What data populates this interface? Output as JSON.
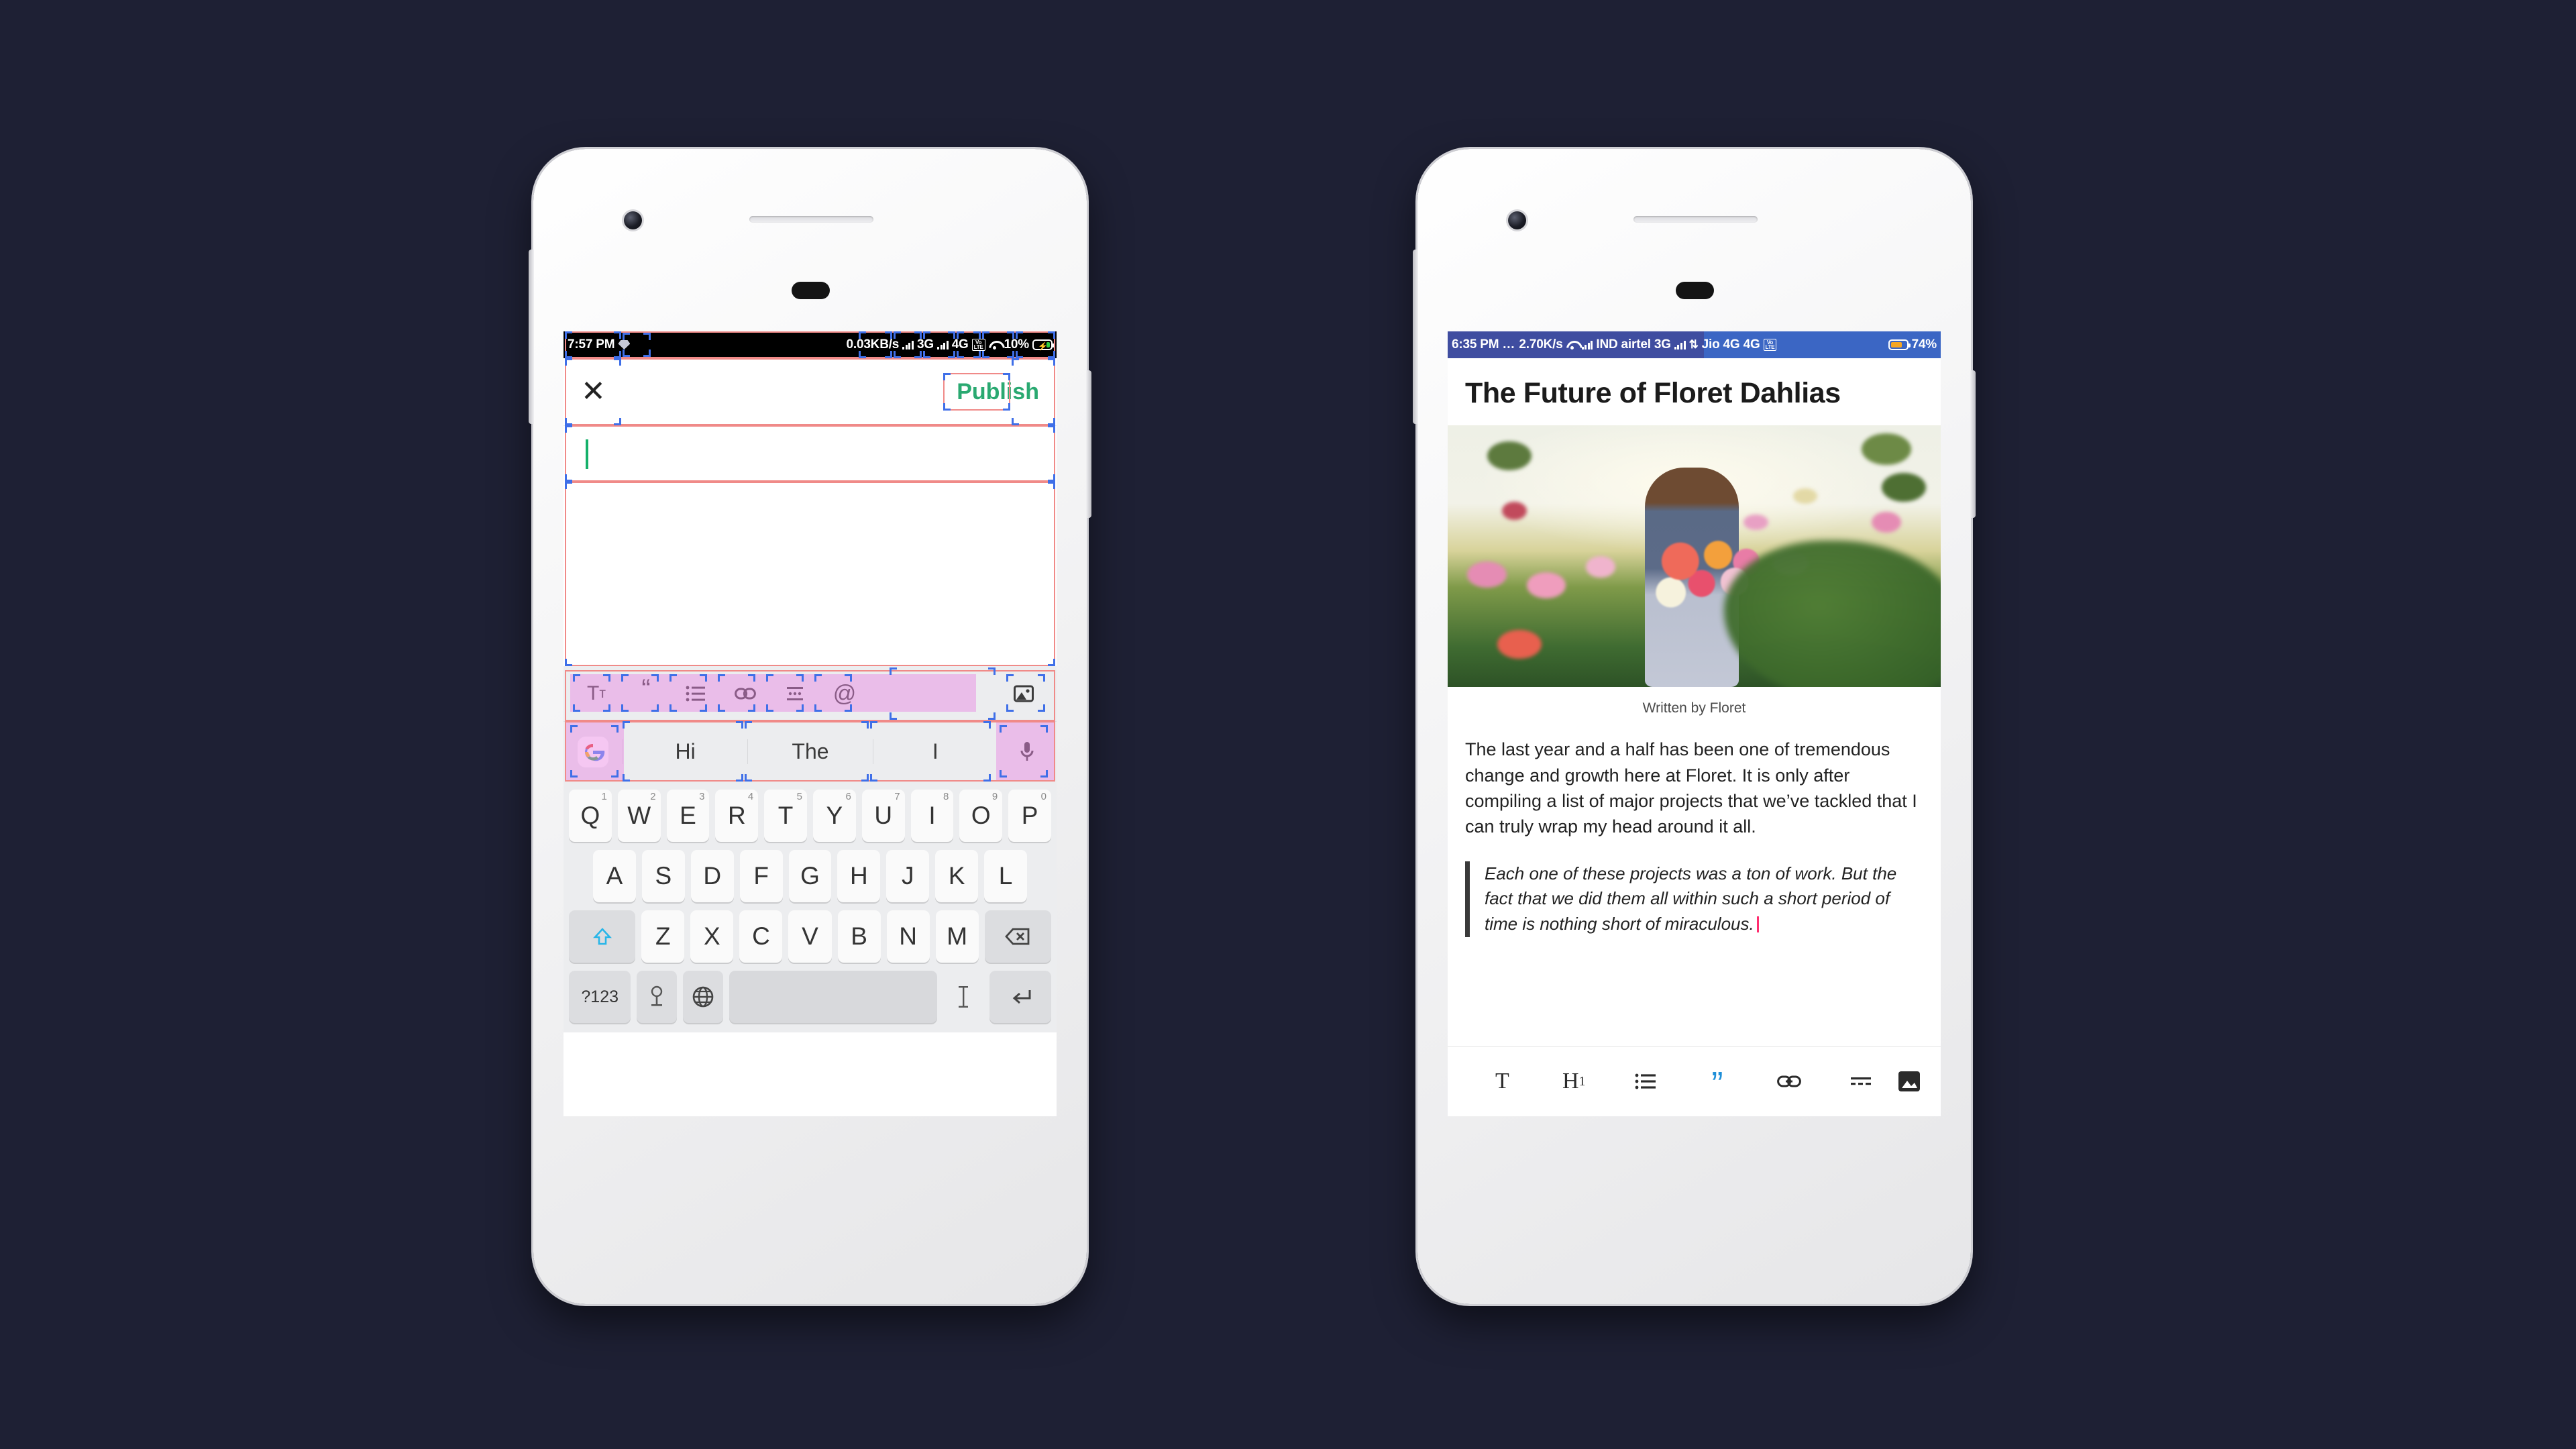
{
  "background_color": "#1e2034",
  "left_phone": {
    "name": "editor-phone",
    "status_bar": {
      "time": "7:57 PM",
      "left_icon": "diamond-icon",
      "net_speed": "0.03KB/s",
      "sim1_network": "3G",
      "sim2_network": "4G",
      "volte": "VoLTE",
      "wifi": "wifi-icon",
      "battery_percent": "10%",
      "battery_state": "charging",
      "battery_color": "#2ecc40"
    },
    "app_bar": {
      "close_icon": "✕",
      "publish_label": "Publish",
      "publish_color": "#2aa971"
    },
    "title_field": {
      "value": "",
      "placeholder": "",
      "caret_color": "#15b06a"
    },
    "body_field": {
      "value": "",
      "placeholder": ""
    },
    "keyboard": {
      "format_toolbar": [
        {
          "icon": "text-size-icon",
          "glyph": "Tᴛ"
        },
        {
          "icon": "quote-icon",
          "glyph": "❝"
        },
        {
          "icon": "bullet-list-icon",
          "glyph": "list"
        },
        {
          "icon": "link-icon",
          "glyph": "link"
        },
        {
          "icon": "divider-icon",
          "glyph": "divider"
        },
        {
          "icon": "mention-icon",
          "glyph": "@"
        },
        {
          "icon": "image-icon",
          "glyph": "image"
        }
      ],
      "suggestions": [
        "Hi",
        "The",
        "I"
      ],
      "google_icon": "google-g-icon",
      "mic_icon": "microphone-icon",
      "row1": [
        {
          "k": "Q",
          "n": "1"
        },
        {
          "k": "W",
          "n": "2"
        },
        {
          "k": "E",
          "n": "3"
        },
        {
          "k": "R",
          "n": "4"
        },
        {
          "k": "T",
          "n": "5"
        },
        {
          "k": "Y",
          "n": "6"
        },
        {
          "k": "U",
          "n": "7"
        },
        {
          "k": "I",
          "n": "8"
        },
        {
          "k": "O",
          "n": "9"
        },
        {
          "k": "P",
          "n": "0"
        }
      ],
      "row2": [
        "A",
        "S",
        "D",
        "F",
        "G",
        "H",
        "J",
        "K",
        "L"
      ],
      "row3_shift": "shift-icon",
      "row3": [
        "Z",
        "X",
        "C",
        "V",
        "B",
        "N",
        "M"
      ],
      "row3_backspace": "backspace-icon",
      "row4": {
        "symbols": "?123",
        "sticker": "sticker-icon",
        "globe": "globe-icon",
        "space": "",
        "cursor": "text-cursor-icon",
        "enter": "enter-icon"
      }
    }
  },
  "right_phone": {
    "name": "article-preview-phone",
    "status_bar": {
      "time": "6:35 PM",
      "dots": "…",
      "net_speed": "2.70K/s",
      "wifi": "wifi-icon",
      "sim1_label": "IND airtel 3G",
      "sim2_label": "Jio 4G 4G",
      "volte": "VoLTE",
      "battery_percent": "74%",
      "battery_color": "#f5a623"
    },
    "article": {
      "title": "The Future of Floret Dahlias",
      "hero_image_alt": "woman-holding-dahlias-in-field",
      "byline": "Written by Floret",
      "paragraph": "The last year and a half has been one of tremendous change and growth here at Floret. It is only after compiling a list of major projects that we’ve tackled that I can truly wrap my head around it all.",
      "blockquote": "Each one of these projects was a ton of work. But the fact that we did them all within such a short period of time is nothing short of miraculous.",
      "caret_color": "#ff2d6f"
    },
    "toolbar": [
      {
        "icon": "text-style-icon",
        "glyph": "T",
        "active": false
      },
      {
        "icon": "heading-one-icon",
        "glyph": "H₁",
        "active": false
      },
      {
        "icon": "bullet-list-icon",
        "glyph": "list",
        "active": false
      },
      {
        "icon": "blockquote-icon",
        "glyph": "”",
        "active": true
      },
      {
        "icon": "link-icon",
        "glyph": "link",
        "active": false
      },
      {
        "icon": "horizontal-rule-icon",
        "glyph": "hr",
        "active": false
      },
      {
        "icon": "insert-image-icon",
        "glyph": "image",
        "active": false
      }
    ],
    "accent_color": "#1f8fd8"
  }
}
